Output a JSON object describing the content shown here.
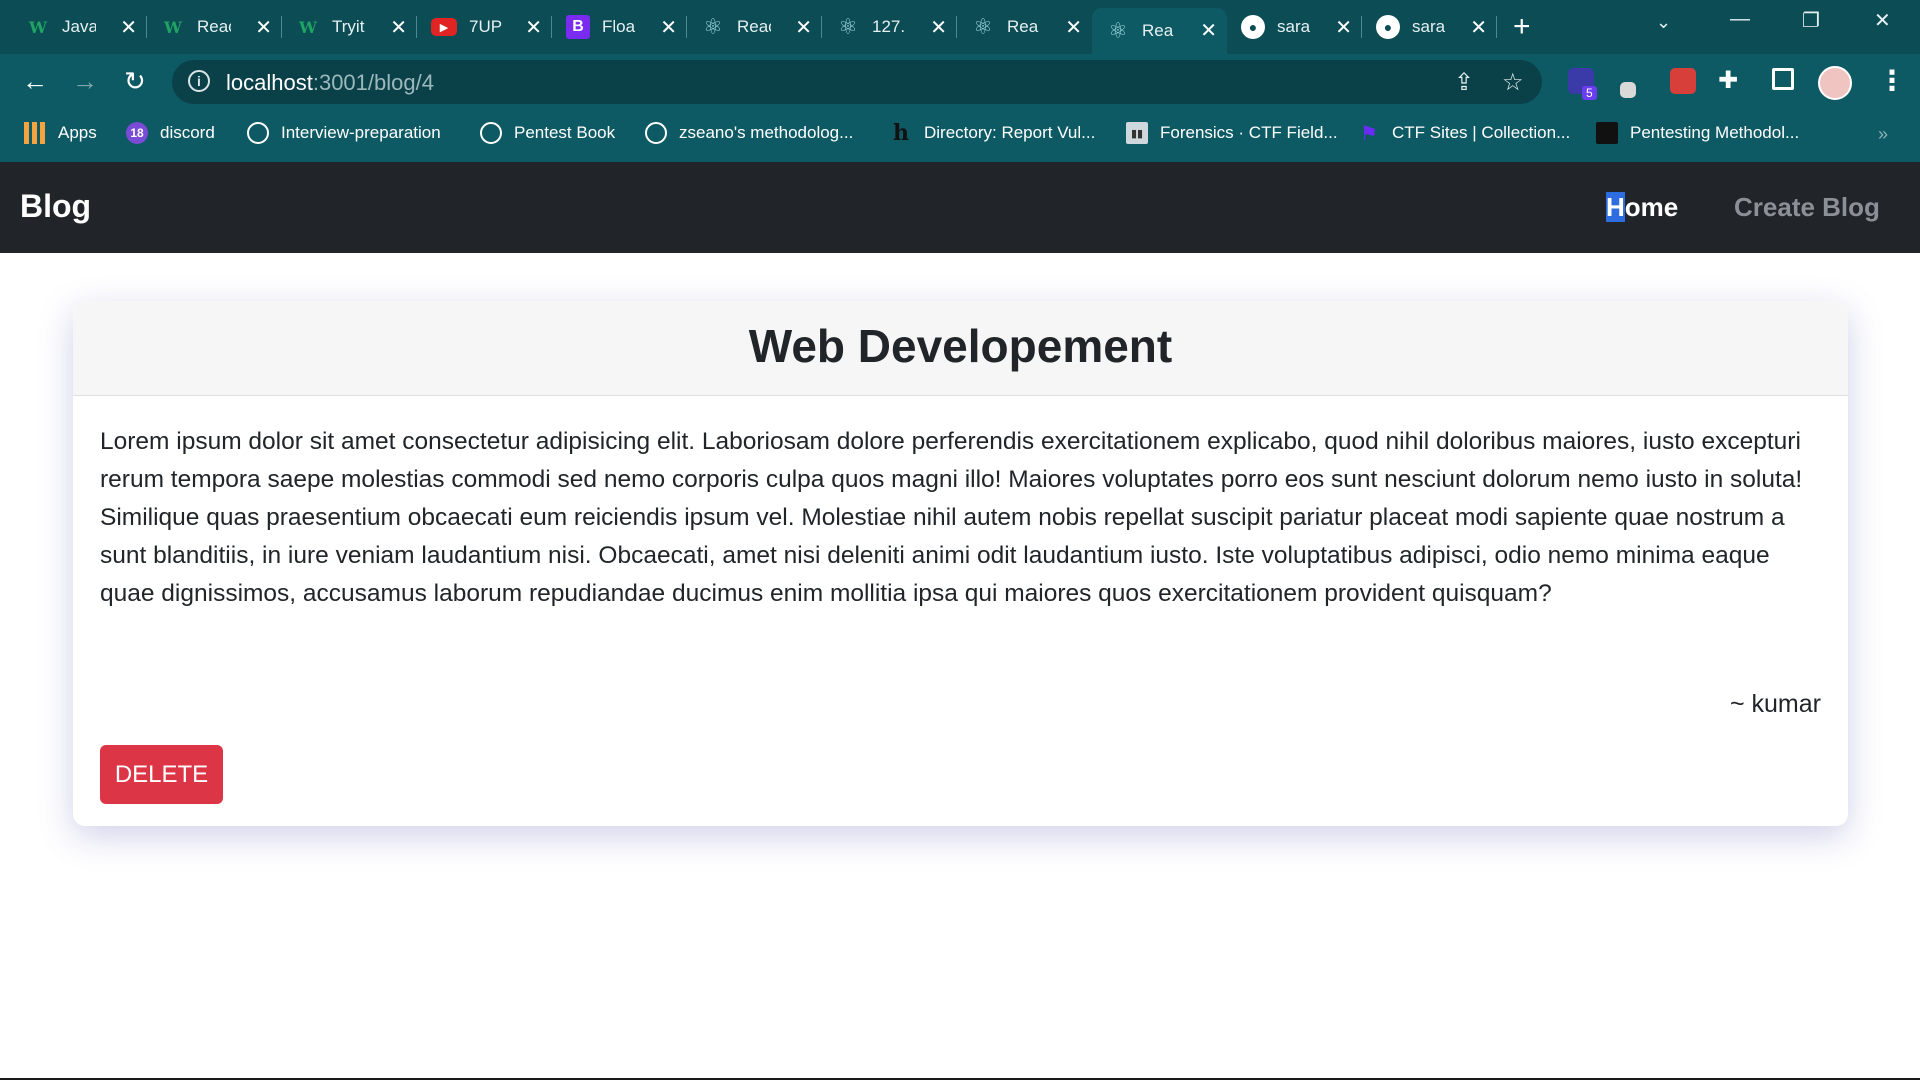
{
  "browser": {
    "tabs": [
      {
        "title": "Java",
        "icon": "w3schools-icon"
      },
      {
        "title": "Reac",
        "icon": "w3schools-icon"
      },
      {
        "title": "Tryit",
        "icon": "w3schools-icon"
      },
      {
        "title": "7UP",
        "icon": "youtube-icon"
      },
      {
        "title": "Floa",
        "icon": "bootstrap-icon"
      },
      {
        "title": "Reac",
        "icon": "react-icon"
      },
      {
        "title": "127.",
        "icon": "react-icon"
      },
      {
        "title": "Rea",
        "icon": "react-icon"
      },
      {
        "title": "Rea",
        "icon": "react-icon",
        "active": true
      },
      {
        "title": "sara",
        "icon": "github-icon"
      },
      {
        "title": "sara",
        "icon": "github-icon"
      }
    ],
    "address": {
      "host": "localhost",
      "rest": ":3001/blog/4"
    },
    "extension_badge": "5",
    "bookmarks": [
      {
        "label": "Apps",
        "icon": "apps-icon"
      },
      {
        "label": "discord",
        "icon": "discord-icon",
        "badge": "18"
      },
      {
        "label": "Interview-preparation",
        "icon": "globe-icon"
      },
      {
        "label": "Pentest Book",
        "icon": "globe-icon"
      },
      {
        "label": "zseano's methodolog...",
        "icon": "globe-icon"
      },
      {
        "label": "Directory: Report Vul...",
        "icon": "hackerone-icon"
      },
      {
        "label": "Forensics · CTF Field...",
        "icon": "book-icon"
      },
      {
        "label": "CTF Sites | Collection...",
        "icon": "flag-icon"
      },
      {
        "label": "Pentesting Methodol...",
        "icon": "pen-icon"
      }
    ]
  },
  "page": {
    "brand": "Blog",
    "nav": {
      "home_first": "H",
      "home_rest": "ome",
      "create": "Create Blog"
    },
    "post": {
      "title": "Web Developement",
      "body": "Lorem ipsum dolor sit amet consectetur adipisicing elit. Laboriosam dolore perferendis exercitationem explicabo, quod nihil doloribus maiores, iusto excepturi rerum tempora saepe molestias commodi sed nemo corporis culpa quos magni illo! Maiores voluptates porro eos sunt nesciunt dolorum nemo iusto in soluta! Similique quas praesentium obcaecati eum reiciendis ipsum vel. Molestiae nihil autem nobis repellat suscipit pariatur placeat modi sapiente quae nostrum a sunt blanditiis, in iure veniam laudantium nisi. Obcaecati, amet nisi deleniti animi odit laudantium iusto. Iste voluptatibus adipisci, odio nemo minima eaque quae dignissimos, accusamus laborum repudiandae ducimus enim mollitia ipsa qui maiores quos exercitationem provident quisquam?",
      "author": "~ kumar",
      "delete_label": "DELETE"
    }
  },
  "colors": {
    "navbar": "#212529",
    "delete": "#dc3545",
    "chrome": "#0d5a64"
  }
}
